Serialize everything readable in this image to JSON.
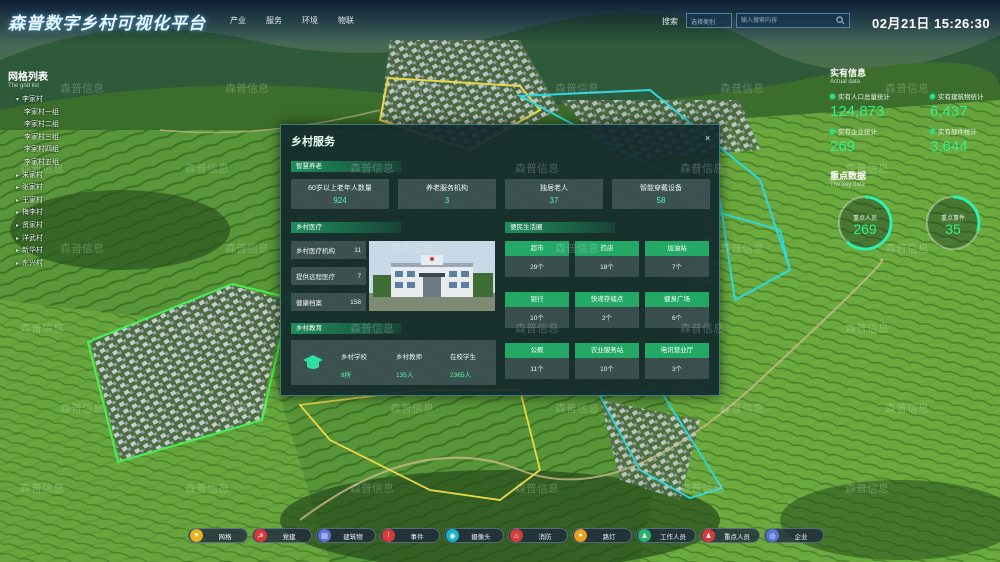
{
  "header": {
    "title": "森普数字乡村可视化平台",
    "nav": [
      "产业",
      "服务",
      "环境",
      "物联"
    ],
    "search_label": "搜索",
    "search_select": "选择类别",
    "search_placeholder": "输入搜索内容",
    "datetime": "02月21日 15:26:30"
  },
  "left_panel": {
    "title": "网格列表",
    "subtitle": "The grid list",
    "items": [
      {
        "label": "李家村",
        "level": "root",
        "expanded": true
      },
      {
        "label": "李家村一组",
        "level": "child"
      },
      {
        "label": "李家村二组",
        "level": "child"
      },
      {
        "label": "李家村三组",
        "level": "child"
      },
      {
        "label": "李家村四组",
        "level": "child"
      },
      {
        "label": "李家村五组",
        "level": "child"
      },
      {
        "label": "朱家村",
        "level": "root"
      },
      {
        "label": "张家村",
        "level": "root"
      },
      {
        "label": "王家村",
        "level": "root"
      },
      {
        "label": "梅李村",
        "level": "root"
      },
      {
        "label": "贤家村",
        "level": "root"
      },
      {
        "label": "洋武村",
        "level": "root"
      },
      {
        "label": "新华村",
        "level": "root"
      },
      {
        "label": "东兴村",
        "level": "root"
      }
    ]
  },
  "right_panel": {
    "title": "实有信息",
    "subtitle": "Actual data",
    "stats": [
      {
        "label": "实有人口总量统计",
        "value": "124,873"
      },
      {
        "label": "实有建筑物统计",
        "value": "6,437"
      },
      {
        "label": "实有企业统计",
        "value": "269"
      },
      {
        "label": "实有部件统计",
        "value": "3,644"
      }
    ],
    "key_title": "重点数据",
    "key_subtitle": "The key data",
    "rings": [
      {
        "label": "重点人员",
        "value": "269",
        "fraction": 0.62
      },
      {
        "label": "重点事件",
        "value": "35",
        "fraction": 0.3
      }
    ]
  },
  "modal": {
    "title": "乡村服务",
    "close": "×",
    "elderly": {
      "label": "智慧养老",
      "cards": [
        {
          "label": "60岁以上老年人数量",
          "value": "924"
        },
        {
          "label": "养老服务机构",
          "value": "3"
        },
        {
          "label": "独居老人",
          "value": "37"
        },
        {
          "label": "智能穿戴设备",
          "value": "58"
        }
      ]
    },
    "medical": {
      "label": "乡村医疗",
      "rows": [
        {
          "label": "乡村医疗机构",
          "value": "11"
        },
        {
          "label": "提供远程医疗",
          "value": "7"
        },
        {
          "label": "健康档案",
          "value": "158"
        }
      ]
    },
    "education": {
      "label": "乡村教育",
      "cols": [
        {
          "label": "乡村学校",
          "value": "8所"
        },
        {
          "label": "乡村教师",
          "value": "135人"
        },
        {
          "label": "在校学生",
          "value": "2365人"
        }
      ]
    },
    "life": {
      "label": "便民生活圈",
      "tiles": [
        {
          "label": "超市",
          "value": "29个"
        },
        {
          "label": "药店",
          "value": "18个"
        },
        {
          "label": "加油站",
          "value": "7个"
        },
        {
          "label": "银行",
          "value": "10个"
        },
        {
          "label": "快递存储点",
          "value": "2个"
        },
        {
          "label": "健身广场",
          "value": "6个"
        },
        {
          "label": "公厕",
          "value": "11个"
        },
        {
          "label": "农业服务站",
          "value": "10个"
        },
        {
          "label": "电讯营业厅",
          "value": "3个"
        }
      ]
    }
  },
  "toolbar": [
    {
      "label": "网格",
      "icon": "grid-icon",
      "color": "#e8b320",
      "glyph": "♥"
    },
    {
      "label": "党建",
      "icon": "party-icon",
      "color": "#d63a3a",
      "glyph": "☭"
    },
    {
      "label": "建筑物",
      "icon": "building-icon",
      "color": "#5b74d8",
      "glyph": "▤"
    },
    {
      "label": "事件",
      "icon": "alert-icon",
      "color": "#d63a3a",
      "glyph": "!"
    },
    {
      "label": "摄像头",
      "icon": "camera-icon",
      "color": "#19b3c7",
      "glyph": "◉"
    },
    {
      "label": "消防",
      "icon": "fire-icon",
      "color": "#d63a3a",
      "glyph": "♨"
    },
    {
      "label": "路灯",
      "icon": "lamp-icon",
      "color": "#e8a020",
      "glyph": "●"
    },
    {
      "label": "工作人员",
      "icon": "staff-icon",
      "color": "#2ab36d",
      "glyph": "♟"
    },
    {
      "label": "重点人员",
      "icon": "key-person-icon",
      "color": "#d63a3a",
      "glyph": "♟"
    },
    {
      "label": "企业",
      "icon": "enterprise-icon",
      "color": "#5b74d8",
      "glyph": "◎"
    }
  ],
  "watermark": "森普信息"
}
